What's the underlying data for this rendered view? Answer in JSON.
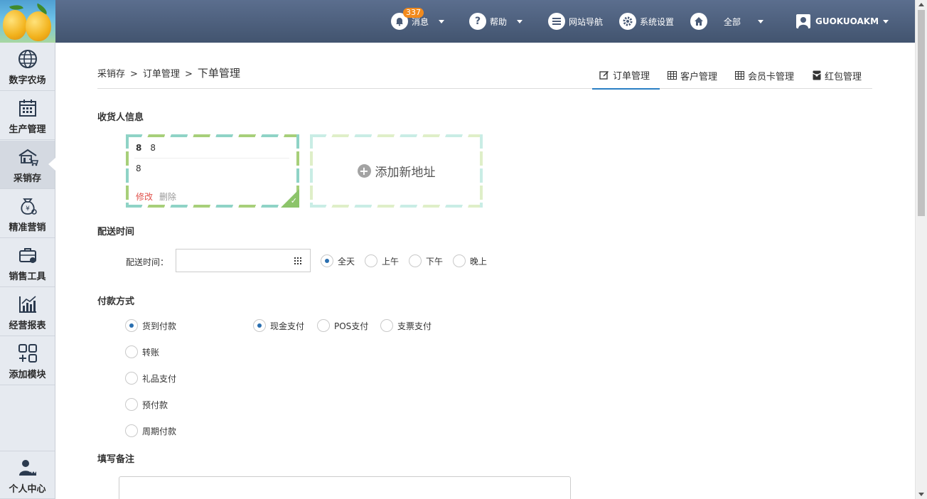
{
  "sidebar": {
    "items": [
      {
        "label": "数字农场",
        "icon": "globe-icon"
      },
      {
        "label": "生产管理",
        "icon": "calendar-icon"
      },
      {
        "label": "采销存",
        "icon": "warehouse-cart-icon"
      },
      {
        "label": "精准营销",
        "icon": "money-bag-icon"
      },
      {
        "label": "销售工具",
        "icon": "briefcase-icon"
      },
      {
        "label": "经营报表",
        "icon": "chart-icon"
      },
      {
        "label": "添加模块",
        "icon": "add-module-icon"
      }
    ],
    "bottom": {
      "label": "个人中心",
      "icon": "user-crown-icon"
    }
  },
  "topbar": {
    "messages": {
      "label": "消息",
      "badge": "337"
    },
    "help": {
      "label": "帮助"
    },
    "site_nav": {
      "label": "网站导航"
    },
    "settings": {
      "label": "系统设置"
    },
    "home": {
      "label": "全部"
    },
    "user": {
      "name": "GUOKUOAKM"
    }
  },
  "breadcrumb": {
    "root": "采销存",
    "sep1": ">",
    "mid": "订单管理",
    "sep2": ">",
    "current": "下单管理"
  },
  "tabs": [
    {
      "label": "订单管理",
      "icon": "edit-icon"
    },
    {
      "label": "客户管理",
      "icon": "table-icon"
    },
    {
      "label": "会员卡管理",
      "icon": "table-icon"
    },
    {
      "label": "红包管理",
      "icon": "redpacket-icon"
    }
  ],
  "receiver": {
    "title": "收货人信息",
    "card": {
      "name": "8",
      "phone": "8",
      "address": "8",
      "edit": "修改",
      "delete": "删除"
    },
    "add_label": "添加新地址"
  },
  "delivery": {
    "title": "配送时间",
    "label": "配送时间：",
    "date_value": "",
    "options": [
      "全天",
      "上午",
      "下午",
      "晚上"
    ],
    "selected": "全天"
  },
  "payment": {
    "title": "付款方式",
    "methods": [
      "货到付款",
      "转账",
      "礼品支付",
      "预付款",
      "周期付款"
    ],
    "selected_method": "货到付款",
    "cod_options": [
      "现金支付",
      "POS支付",
      "支票支付"
    ],
    "selected_cod": "现金支付"
  },
  "remark": {
    "title": "填写备注",
    "value": ""
  },
  "colors": {
    "topbar": "#4d5f7d",
    "accent": "#2a7fc4",
    "edit": "#e0524c"
  }
}
